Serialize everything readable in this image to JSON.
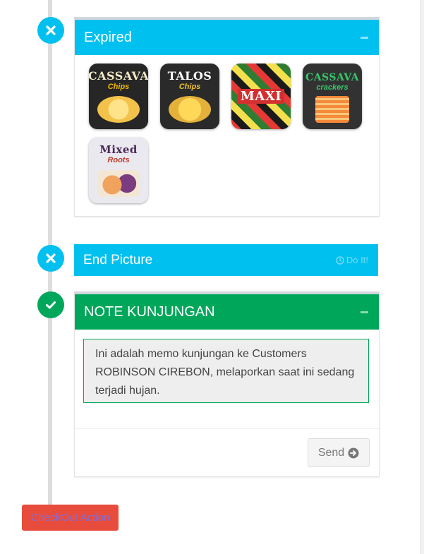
{
  "timeline": {
    "sections": {
      "expired": {
        "title": "Expired",
        "status_icon": "times-icon",
        "collapse_icon": "minus-icon",
        "products": [
          {
            "brand": "CASSAVA",
            "sub": "Chips"
          },
          {
            "brand": "TALOS",
            "sub": "Chips"
          },
          {
            "brand": "MAXI",
            "sub": ""
          },
          {
            "brand": "CASSAVA",
            "sub": "crackers"
          },
          {
            "brand": "Mixed",
            "sub": "Roots"
          }
        ]
      },
      "end_picture": {
        "title": "End Picture",
        "status_icon": "times-icon",
        "action_icon": "clock-icon",
        "action_label": "Do It!"
      },
      "note": {
        "title": "NOTE KUNJUNGAN",
        "status_icon": "check-icon",
        "collapse_icon": "minus-icon",
        "memo_text": "Ini adalah memo kunjungan ke Customers ROBINSON CIREBON, melaporkan saat ini sedang terjadi hujan.",
        "send_label": "Send",
        "send_icon": "arrow-circle-right-icon"
      }
    }
  },
  "footer": {
    "checkout_label": "CheckOut Action"
  },
  "colors": {
    "info": "#00c0ef",
    "success": "#00a65a",
    "danger": "#e74c3c"
  }
}
